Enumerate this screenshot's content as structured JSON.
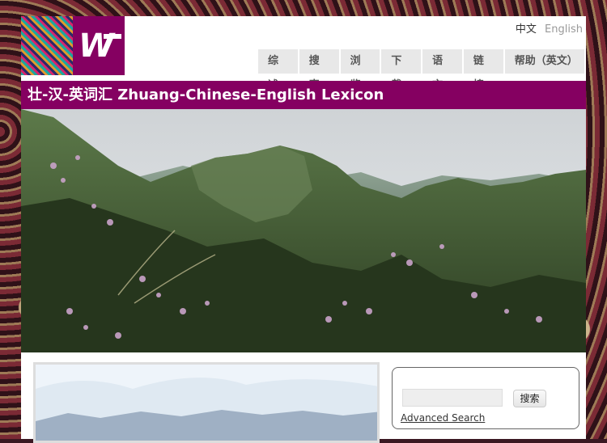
{
  "header": {
    "lang_zh": "中文",
    "lang_en": "English"
  },
  "nav": {
    "items": [
      {
        "label": "综述"
      },
      {
        "label": "搜索"
      },
      {
        "label": "浏览"
      },
      {
        "label": "下载"
      },
      {
        "label": "语言"
      },
      {
        "label": "链接"
      },
      {
        "label": "帮助（英文）"
      }
    ]
  },
  "title": "壮-汉-英词汇 Zhuang-Chinese-English Lexicon",
  "search": {
    "button_label": "搜索",
    "advanced_link": "Advanced Search",
    "value": ""
  },
  "colors": {
    "brand": "#850061",
    "nav_bg": "#e8e8e8"
  },
  "icons": {
    "logo": "w-logo-mark"
  }
}
